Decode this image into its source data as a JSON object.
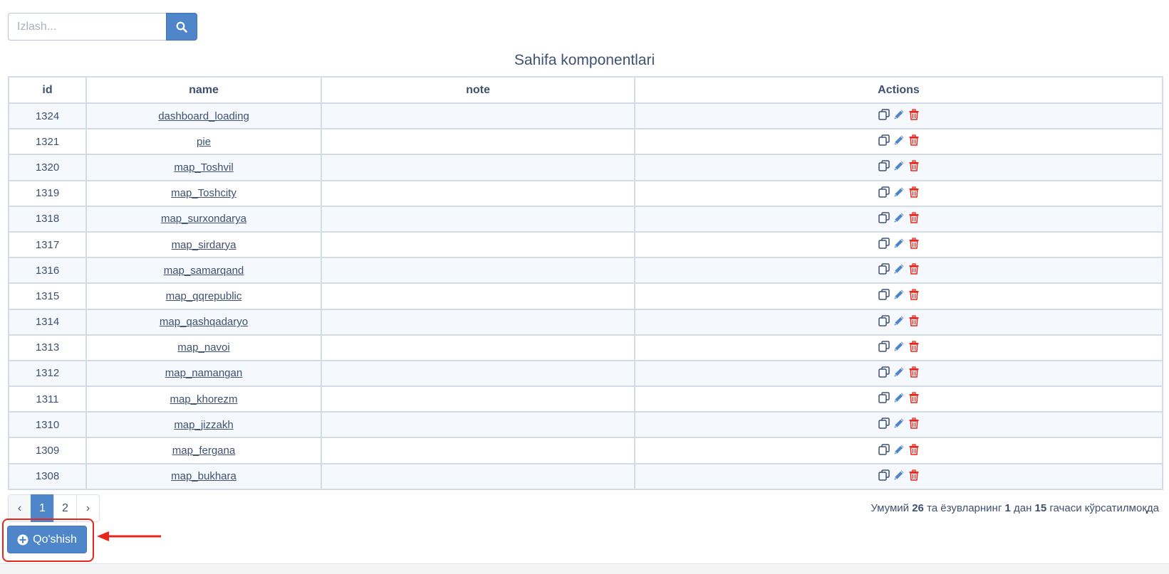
{
  "search": {
    "placeholder": "Izlash..."
  },
  "page_title": "Sahifa komponentlari",
  "table": {
    "columns": [
      "id",
      "name",
      "note",
      "Actions"
    ],
    "rows": [
      {
        "id": "1324",
        "name": "dashboard_loading",
        "note": ""
      },
      {
        "id": "1321",
        "name": "pie",
        "note": ""
      },
      {
        "id": "1320",
        "name": "map_Toshvil",
        "note": ""
      },
      {
        "id": "1319",
        "name": "map_Toshcity",
        "note": ""
      },
      {
        "id": "1318",
        "name": "map_surxondarya",
        "note": ""
      },
      {
        "id": "1317",
        "name": "map_sirdarya",
        "note": ""
      },
      {
        "id": "1316",
        "name": "map_samarqand",
        "note": ""
      },
      {
        "id": "1315",
        "name": "map_qqrepublic",
        "note": ""
      },
      {
        "id": "1314",
        "name": "map_qashqadaryo",
        "note": ""
      },
      {
        "id": "1313",
        "name": "map_navoi",
        "note": ""
      },
      {
        "id": "1312",
        "name": "map_namangan",
        "note": ""
      },
      {
        "id": "1311",
        "name": "map_khorezm",
        "note": ""
      },
      {
        "id": "1310",
        "name": "map_jizzakh",
        "note": ""
      },
      {
        "id": "1309",
        "name": "map_fergana",
        "note": ""
      },
      {
        "id": "1308",
        "name": "map_bukhara",
        "note": ""
      }
    ],
    "row_actions": [
      "copy-icon",
      "edit-icon",
      "delete-icon"
    ]
  },
  "pagination": {
    "prev": "‹",
    "pages": [
      "1",
      "2"
    ],
    "active": "1",
    "next": "›"
  },
  "summary": {
    "prefix": "Умумий ",
    "total": "26",
    "mid1": " та ёзувларнинг ",
    "from": "1",
    "mid2": " дан ",
    "to": "15",
    "suffix": " гачаси кўрсатилмоқда"
  },
  "add_button": {
    "label": "Qo'shish",
    "icon": "plus-circle-icon"
  },
  "colors": {
    "primary": "#4f85c9",
    "text": "#3f5170",
    "danger": "#e8261c",
    "highlight": "#e8261c"
  }
}
